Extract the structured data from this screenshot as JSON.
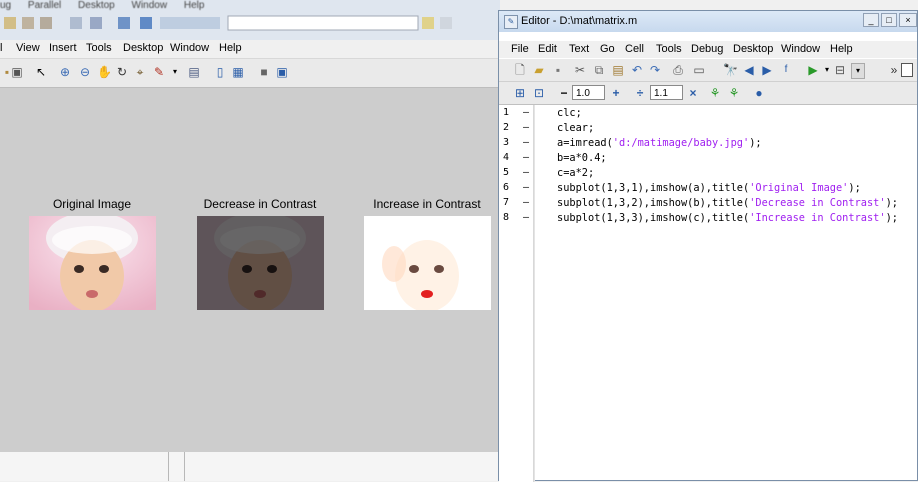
{
  "background": {
    "menu": [
      "ug",
      "Parallel",
      "Desktop",
      "Window",
      "Help"
    ]
  },
  "figure": {
    "menu": [
      "l",
      "View",
      "Insert",
      "Tools",
      "Desktop",
      "Window",
      "Help"
    ],
    "axes": [
      {
        "title": "Original Image"
      },
      {
        "title": "Decrease in Contrast"
      },
      {
        "title": "Increase in Contrast"
      }
    ]
  },
  "editor": {
    "title": "Editor - D:\\mat\\matrix.m",
    "menu": [
      "File",
      "Edit",
      "Text",
      "Go",
      "Cell",
      "Tools",
      "Debug",
      "Desktop",
      "Window",
      "Help"
    ],
    "cell_toolbar": {
      "step1": "1.0",
      "step2": "1.1",
      "minus": "−",
      "plus": "+",
      "divide": "÷",
      "times": "×"
    },
    "lines": [
      {
        "n": "1",
        "code": [
          {
            "t": "clc;",
            "s": false
          }
        ]
      },
      {
        "n": "2",
        "code": [
          {
            "t": "clear;",
            "s": false
          }
        ]
      },
      {
        "n": "3",
        "code": [
          {
            "t": "a=imread(",
            "s": false
          },
          {
            "t": "'d:/matimage/baby.jpg'",
            "s": true
          },
          {
            "t": ");",
            "s": false
          }
        ]
      },
      {
        "n": "4",
        "code": [
          {
            "t": "b=a*0.4;",
            "s": false
          }
        ]
      },
      {
        "n": "5",
        "code": [
          {
            "t": "c=a*2;",
            "s": false
          }
        ]
      },
      {
        "n": "6",
        "code": [
          {
            "t": "subplot(1,3,1),imshow(a),title(",
            "s": false
          },
          {
            "t": "'Original Image'",
            "s": true
          },
          {
            "t": ");",
            "s": false
          }
        ]
      },
      {
        "n": "7",
        "code": [
          {
            "t": "subplot(1,3,2),imshow(b),title(",
            "s": false
          },
          {
            "t": "'Decrease in Contrast'",
            "s": true
          },
          {
            "t": ");",
            "s": false
          }
        ]
      },
      {
        "n": "8",
        "code": [
          {
            "t": "subplot(1,3,3),imshow(c),title(",
            "s": false
          },
          {
            "t": "'Increase in Contrast'",
            "s": true
          },
          {
            "t": ");",
            "s": false
          }
        ]
      }
    ]
  }
}
